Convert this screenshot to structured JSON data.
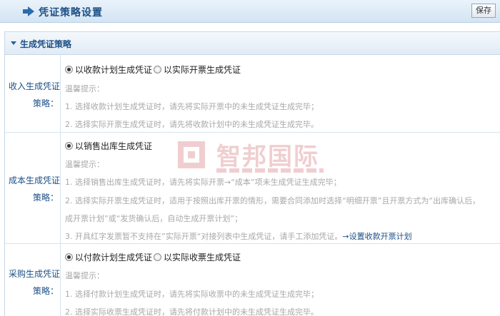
{
  "header": {
    "title": "凭证策略设置",
    "save_label": "保存"
  },
  "panel": {
    "title": "生成凭证策略"
  },
  "income": {
    "label_line1": "收入生成凭证",
    "label_line2": "策略：",
    "options": [
      {
        "label": "以收款计划生成凭证",
        "checked": true
      },
      {
        "label": "以实际开票生成凭证",
        "checked": false
      }
    ],
    "tips_title": "温馨提示：",
    "tips": [
      "1. 选择收款计划生成凭证时，请先将实际开票中的未生成凭证生成完毕；",
      "2. 选择实际开票生成凭证时，请先将收款计划中的未生成凭证生成完毕。"
    ]
  },
  "cost": {
    "label_line1": "成本生成凭证",
    "label_line2": "策略：",
    "options": [
      {
        "label": "以销售出库生成凭证",
        "checked": true
      }
    ],
    "tips_title": "温馨提示：",
    "tips": [
      "1. 选择销售出库生成凭证时，请先将实际开票→“成本”项未生成凭证生成完毕；",
      "2. 选择实际开票生成凭证时，适用于按照出库开票的情形，需要合同添加时选择“明细开票”且开票方式为“出库确认后，",
      "成开票计划”或“发货确认后，自动生成开票计划”；",
      "3. 开具红字发票暂不支持在”实际开票“对接列表中生成凭证，请手工添加凭证。"
    ],
    "tip_link": "→设置收款开票计划"
  },
  "purchase": {
    "label_line1": "采购生成凭证",
    "label_line2": "策略：",
    "options": [
      {
        "label": "以付款计划生成凭证",
        "checked": true
      },
      {
        "label": "以实际收票生成凭证",
        "checked": false
      }
    ],
    "tips_title": "温馨提示：",
    "tips": [
      "1. 选择付款计划生成凭证时，请先将实际收票中的未生成凭证生成完毕；",
      "2. 选择实际收票生成凭证时，请先将付款计划中的未生成凭证生成完毕。"
    ]
  },
  "watermark": {
    "text": "智邦国际"
  },
  "colors": {
    "accent": "#1d4f86",
    "tip_text": "#a8a8a8",
    "watermark": "#c0272d"
  }
}
